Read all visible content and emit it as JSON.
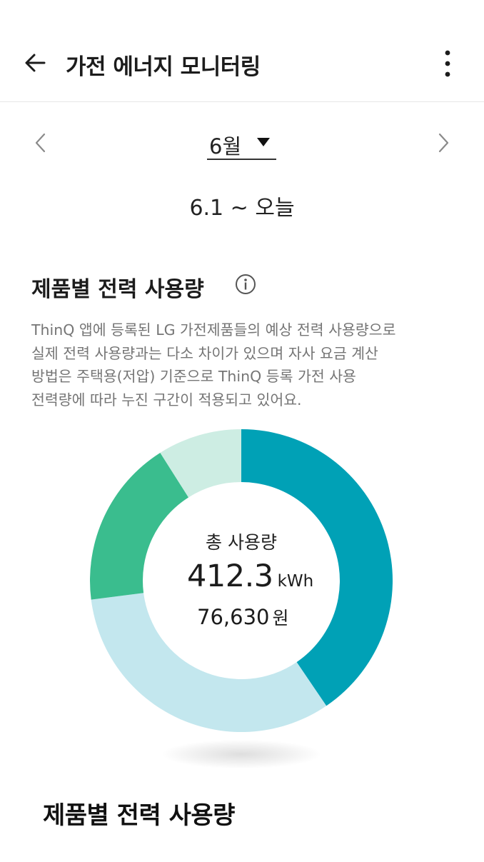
{
  "appbar": {
    "title": "가전 에너지 모니터링",
    "back_icon": "arrow-left-icon",
    "more_icon": "more-vertical-icon"
  },
  "month_nav": {
    "selected_month": "6월",
    "prev_icon": "chevron-left-icon",
    "next_icon": "chevron-right-icon",
    "dropdown_icon": "triangle-down-icon"
  },
  "date_range": "6.1 ~ 오늘",
  "section": {
    "title": "제품별 전력 사용량",
    "info_icon": "info-circle-icon",
    "description_lines": [
      "ThinQ 앱에 등록된 LG 가전제품들의 예상 전력 사용량으로",
      "실제 전력 사용량과는 다소 차이가 있으며 자사 요금 계산",
      "방법은 주택용(저압) 기준으로 ThinQ 등록 가전 사용",
      "전력량에 따라 누진 구간이 적용되고 있어요."
    ]
  },
  "summary": {
    "label": "총 사용량",
    "usage_value": "412.3",
    "usage_unit": "kWh",
    "cost_value": "76,630",
    "cost_unit": "원"
  },
  "colors": {
    "segment_1": "#00a1b6",
    "segment_2": "#c3e7ee",
    "segment_3": "#3abd8e",
    "segment_4": "#cdede3"
  },
  "chart_data": {
    "type": "pie",
    "variant": "donut",
    "values": [
      0.405,
      0.325,
      0.18,
      0.09
    ],
    "value_unit": "fraction_of_total",
    "colors": [
      "#00a1b6",
      "#c3e7ee",
      "#3abd8e",
      "#cdede3"
    ],
    "title": "제품별 전력 사용량"
  },
  "caption": "제품별 전력 사용량"
}
